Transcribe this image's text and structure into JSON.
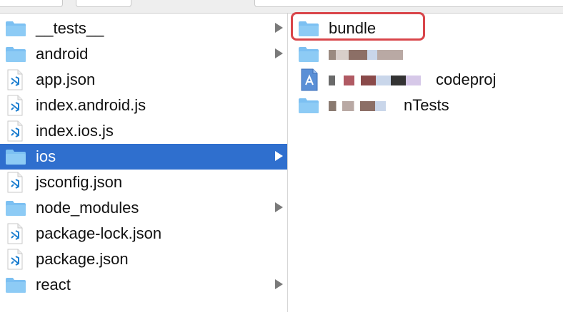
{
  "left_column": {
    "items": [
      {
        "label": "__tests__",
        "icon": "folder-icon",
        "has_children": true,
        "selected": false
      },
      {
        "label": "android",
        "icon": "folder-icon",
        "has_children": true,
        "selected": false
      },
      {
        "label": "app.json",
        "icon": "vscode-file-icon",
        "has_children": false,
        "selected": false
      },
      {
        "label": "index.android.js",
        "icon": "vscode-file-icon",
        "has_children": false,
        "selected": false
      },
      {
        "label": "index.ios.js",
        "icon": "vscode-file-icon",
        "has_children": false,
        "selected": false
      },
      {
        "label": "ios",
        "icon": "folder-icon",
        "has_children": true,
        "selected": true
      },
      {
        "label": "jsconfig.json",
        "icon": "vscode-file-icon",
        "has_children": false,
        "selected": false
      },
      {
        "label": "node_modules",
        "icon": "folder-icon",
        "has_children": true,
        "selected": false
      },
      {
        "label": "package-lock.json",
        "icon": "vscode-file-icon",
        "has_children": false,
        "selected": false
      },
      {
        "label": "package.json",
        "icon": "vscode-file-icon",
        "has_children": false,
        "selected": false
      },
      {
        "label": "react",
        "icon": "folder-icon",
        "has_children": true,
        "selected": false
      }
    ]
  },
  "right_column": {
    "items": [
      {
        "label": "bundle",
        "icon": "folder-icon",
        "highlighted": true
      },
      {
        "label": "",
        "icon": "folder-icon",
        "redacted": true
      },
      {
        "label": "codeproj",
        "icon": "xcode-project-icon",
        "redacted": true
      },
      {
        "label": "nTests",
        "icon": "folder-icon",
        "redacted": true
      }
    ]
  },
  "colors": {
    "selection": "#2f6fce",
    "highlight_border": "#d9454a",
    "folder": "#7cc0f2"
  }
}
